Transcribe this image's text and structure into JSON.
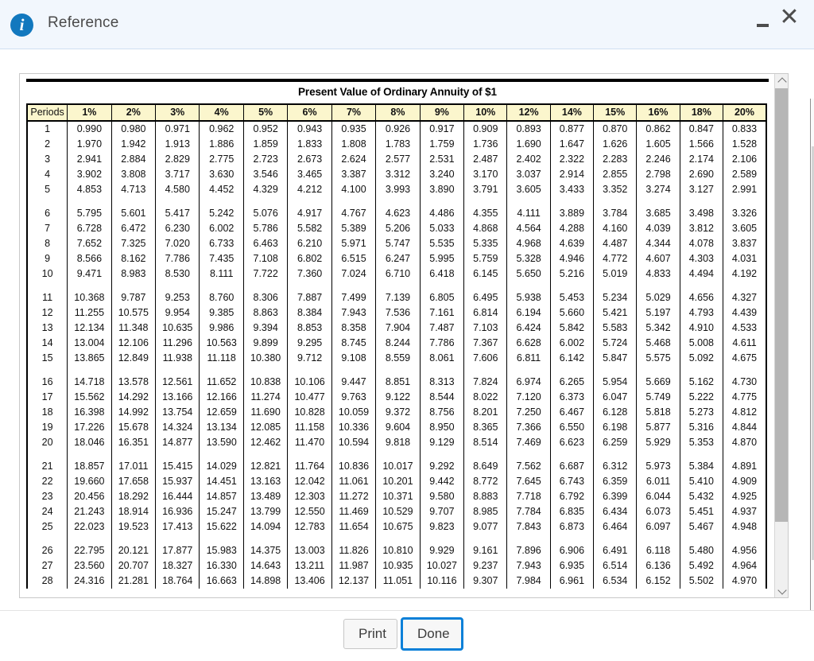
{
  "window": {
    "title": "Reference",
    "info_icon": "info-icon",
    "minimize_label": "minimize-icon",
    "close_label": "close-icon"
  },
  "footer": {
    "print_label": "Print",
    "done_label": "Done"
  },
  "colors": {
    "titlebar_bg": "#f2f7fd",
    "info_blue": "#1278be",
    "header_yellow": "#fbf6cd",
    "focus_blue": "#0b80d8"
  },
  "chart_data": {
    "type": "table",
    "title": "Present Value of Ordinary Annuity of $1",
    "columns": [
      "Periods",
      "1%",
      "2%",
      "3%",
      "4%",
      "5%",
      "6%",
      "7%",
      "8%",
      "9%",
      "10%",
      "12%",
      "14%",
      "15%",
      "16%",
      "18%",
      "20%"
    ],
    "row_groups": [
      [
        [
          "1",
          "0.990",
          "0.980",
          "0.971",
          "0.962",
          "0.952",
          "0.943",
          "0.935",
          "0.926",
          "0.917",
          "0.909",
          "0.893",
          "0.877",
          "0.870",
          "0.862",
          "0.847",
          "0.833"
        ],
        [
          "2",
          "1.970",
          "1.942",
          "1.913",
          "1.886",
          "1.859",
          "1.833",
          "1.808",
          "1.783",
          "1.759",
          "1.736",
          "1.690",
          "1.647",
          "1.626",
          "1.605",
          "1.566",
          "1.528"
        ],
        [
          "3",
          "2.941",
          "2.884",
          "2.829",
          "2.775",
          "2.723",
          "2.673",
          "2.624",
          "2.577",
          "2.531",
          "2.487",
          "2.402",
          "2.322",
          "2.283",
          "2.246",
          "2.174",
          "2.106"
        ],
        [
          "4",
          "3.902",
          "3.808",
          "3.717",
          "3.630",
          "3.546",
          "3.465",
          "3.387",
          "3.312",
          "3.240",
          "3.170",
          "3.037",
          "2.914",
          "2.855",
          "2.798",
          "2.690",
          "2.589"
        ],
        [
          "5",
          "4.853",
          "4.713",
          "4.580",
          "4.452",
          "4.329",
          "4.212",
          "4.100",
          "3.993",
          "3.890",
          "3.791",
          "3.605",
          "3.433",
          "3.352",
          "3.274",
          "3.127",
          "2.991"
        ]
      ],
      [
        [
          "6",
          "5.795",
          "5.601",
          "5.417",
          "5.242",
          "5.076",
          "4.917",
          "4.767",
          "4.623",
          "4.486",
          "4.355",
          "4.111",
          "3.889",
          "3.784",
          "3.685",
          "3.498",
          "3.326"
        ],
        [
          "7",
          "6.728",
          "6.472",
          "6.230",
          "6.002",
          "5.786",
          "5.582",
          "5.389",
          "5.206",
          "5.033",
          "4.868",
          "4.564",
          "4.288",
          "4.160",
          "4.039",
          "3.812",
          "3.605"
        ],
        [
          "8",
          "7.652",
          "7.325",
          "7.020",
          "6.733",
          "6.463",
          "6.210",
          "5.971",
          "5.747",
          "5.535",
          "5.335",
          "4.968",
          "4.639",
          "4.487",
          "4.344",
          "4.078",
          "3.837"
        ],
        [
          "9",
          "8.566",
          "8.162",
          "7.786",
          "7.435",
          "7.108",
          "6.802",
          "6.515",
          "6.247",
          "5.995",
          "5.759",
          "5.328",
          "4.946",
          "4.772",
          "4.607",
          "4.303",
          "4.031"
        ],
        [
          "10",
          "9.471",
          "8.983",
          "8.530",
          "8.111",
          "7.722",
          "7.360",
          "7.024",
          "6.710",
          "6.418",
          "6.145",
          "5.650",
          "5.216",
          "5.019",
          "4.833",
          "4.494",
          "4.192"
        ]
      ],
      [
        [
          "11",
          "10.368",
          "9.787",
          "9.253",
          "8.760",
          "8.306",
          "7.887",
          "7.499",
          "7.139",
          "6.805",
          "6.495",
          "5.938",
          "5.453",
          "5.234",
          "5.029",
          "4.656",
          "4.327"
        ],
        [
          "12",
          "11.255",
          "10.575",
          "9.954",
          "9.385",
          "8.863",
          "8.384",
          "7.943",
          "7.536",
          "7.161",
          "6.814",
          "6.194",
          "5.660",
          "5.421",
          "5.197",
          "4.793",
          "4.439"
        ],
        [
          "13",
          "12.134",
          "11.348",
          "10.635",
          "9.986",
          "9.394",
          "8.853",
          "8.358",
          "7.904",
          "7.487",
          "7.103",
          "6.424",
          "5.842",
          "5.583",
          "5.342",
          "4.910",
          "4.533"
        ],
        [
          "14",
          "13.004",
          "12.106",
          "11.296",
          "10.563",
          "9.899",
          "9.295",
          "8.745",
          "8.244",
          "7.786",
          "7.367",
          "6.628",
          "6.002",
          "5.724",
          "5.468",
          "5.008",
          "4.611"
        ],
        [
          "15",
          "13.865",
          "12.849",
          "11.938",
          "11.118",
          "10.380",
          "9.712",
          "9.108",
          "8.559",
          "8.061",
          "7.606",
          "6.811",
          "6.142",
          "5.847",
          "5.575",
          "5.092",
          "4.675"
        ]
      ],
      [
        [
          "16",
          "14.718",
          "13.578",
          "12.561",
          "11.652",
          "10.838",
          "10.106",
          "9.447",
          "8.851",
          "8.313",
          "7.824",
          "6.974",
          "6.265",
          "5.954",
          "5.669",
          "5.162",
          "4.730"
        ],
        [
          "17",
          "15.562",
          "14.292",
          "13.166",
          "12.166",
          "11.274",
          "10.477",
          "9.763",
          "9.122",
          "8.544",
          "8.022",
          "7.120",
          "6.373",
          "6.047",
          "5.749",
          "5.222",
          "4.775"
        ],
        [
          "18",
          "16.398",
          "14.992",
          "13.754",
          "12.659",
          "11.690",
          "10.828",
          "10.059",
          "9.372",
          "8.756",
          "8.201",
          "7.250",
          "6.467",
          "6.128",
          "5.818",
          "5.273",
          "4.812"
        ],
        [
          "19",
          "17.226",
          "15.678",
          "14.324",
          "13.134",
          "12.085",
          "11.158",
          "10.336",
          "9.604",
          "8.950",
          "8.365",
          "7.366",
          "6.550",
          "6.198",
          "5.877",
          "5.316",
          "4.844"
        ],
        [
          "20",
          "18.046",
          "16.351",
          "14.877",
          "13.590",
          "12.462",
          "11.470",
          "10.594",
          "9.818",
          "9.129",
          "8.514",
          "7.469",
          "6.623",
          "6.259",
          "5.929",
          "5.353",
          "4.870"
        ]
      ],
      [
        [
          "21",
          "18.857",
          "17.011",
          "15.415",
          "14.029",
          "12.821",
          "11.764",
          "10.836",
          "10.017",
          "9.292",
          "8.649",
          "7.562",
          "6.687",
          "6.312",
          "5.973",
          "5.384",
          "4.891"
        ],
        [
          "22",
          "19.660",
          "17.658",
          "15.937",
          "14.451",
          "13.163",
          "12.042",
          "11.061",
          "10.201",
          "9.442",
          "8.772",
          "7.645",
          "6.743",
          "6.359",
          "6.011",
          "5.410",
          "4.909"
        ],
        [
          "23",
          "20.456",
          "18.292",
          "16.444",
          "14.857",
          "13.489",
          "12.303",
          "11.272",
          "10.371",
          "9.580",
          "8.883",
          "7.718",
          "6.792",
          "6.399",
          "6.044",
          "5.432",
          "4.925"
        ],
        [
          "24",
          "21.243",
          "18.914",
          "16.936",
          "15.247",
          "13.799",
          "12.550",
          "11.469",
          "10.529",
          "9.707",
          "8.985",
          "7.784",
          "6.835",
          "6.434",
          "6.073",
          "5.451",
          "4.937"
        ],
        [
          "25",
          "22.023",
          "19.523",
          "17.413",
          "15.622",
          "14.094",
          "12.783",
          "11.654",
          "10.675",
          "9.823",
          "9.077",
          "7.843",
          "6.873",
          "6.464",
          "6.097",
          "5.467",
          "4.948"
        ]
      ],
      [
        [
          "26",
          "22.795",
          "20.121",
          "17.877",
          "15.983",
          "14.375",
          "13.003",
          "11.826",
          "10.810",
          "9.929",
          "9.161",
          "7.896",
          "6.906",
          "6.491",
          "6.118",
          "5.480",
          "4.956"
        ],
        [
          "27",
          "23.560",
          "20.707",
          "18.327",
          "16.330",
          "14.643",
          "13.211",
          "11.987",
          "10.935",
          "10.027",
          "9.237",
          "7.943",
          "6.935",
          "6.514",
          "6.136",
          "5.492",
          "4.964"
        ],
        [
          "28",
          "24.316",
          "21.281",
          "18.764",
          "16.663",
          "14.898",
          "13.406",
          "12.137",
          "11.051",
          "10.116",
          "9.307",
          "7.984",
          "6.961",
          "6.534",
          "6.152",
          "5.502",
          "4.970"
        ]
      ]
    ]
  }
}
